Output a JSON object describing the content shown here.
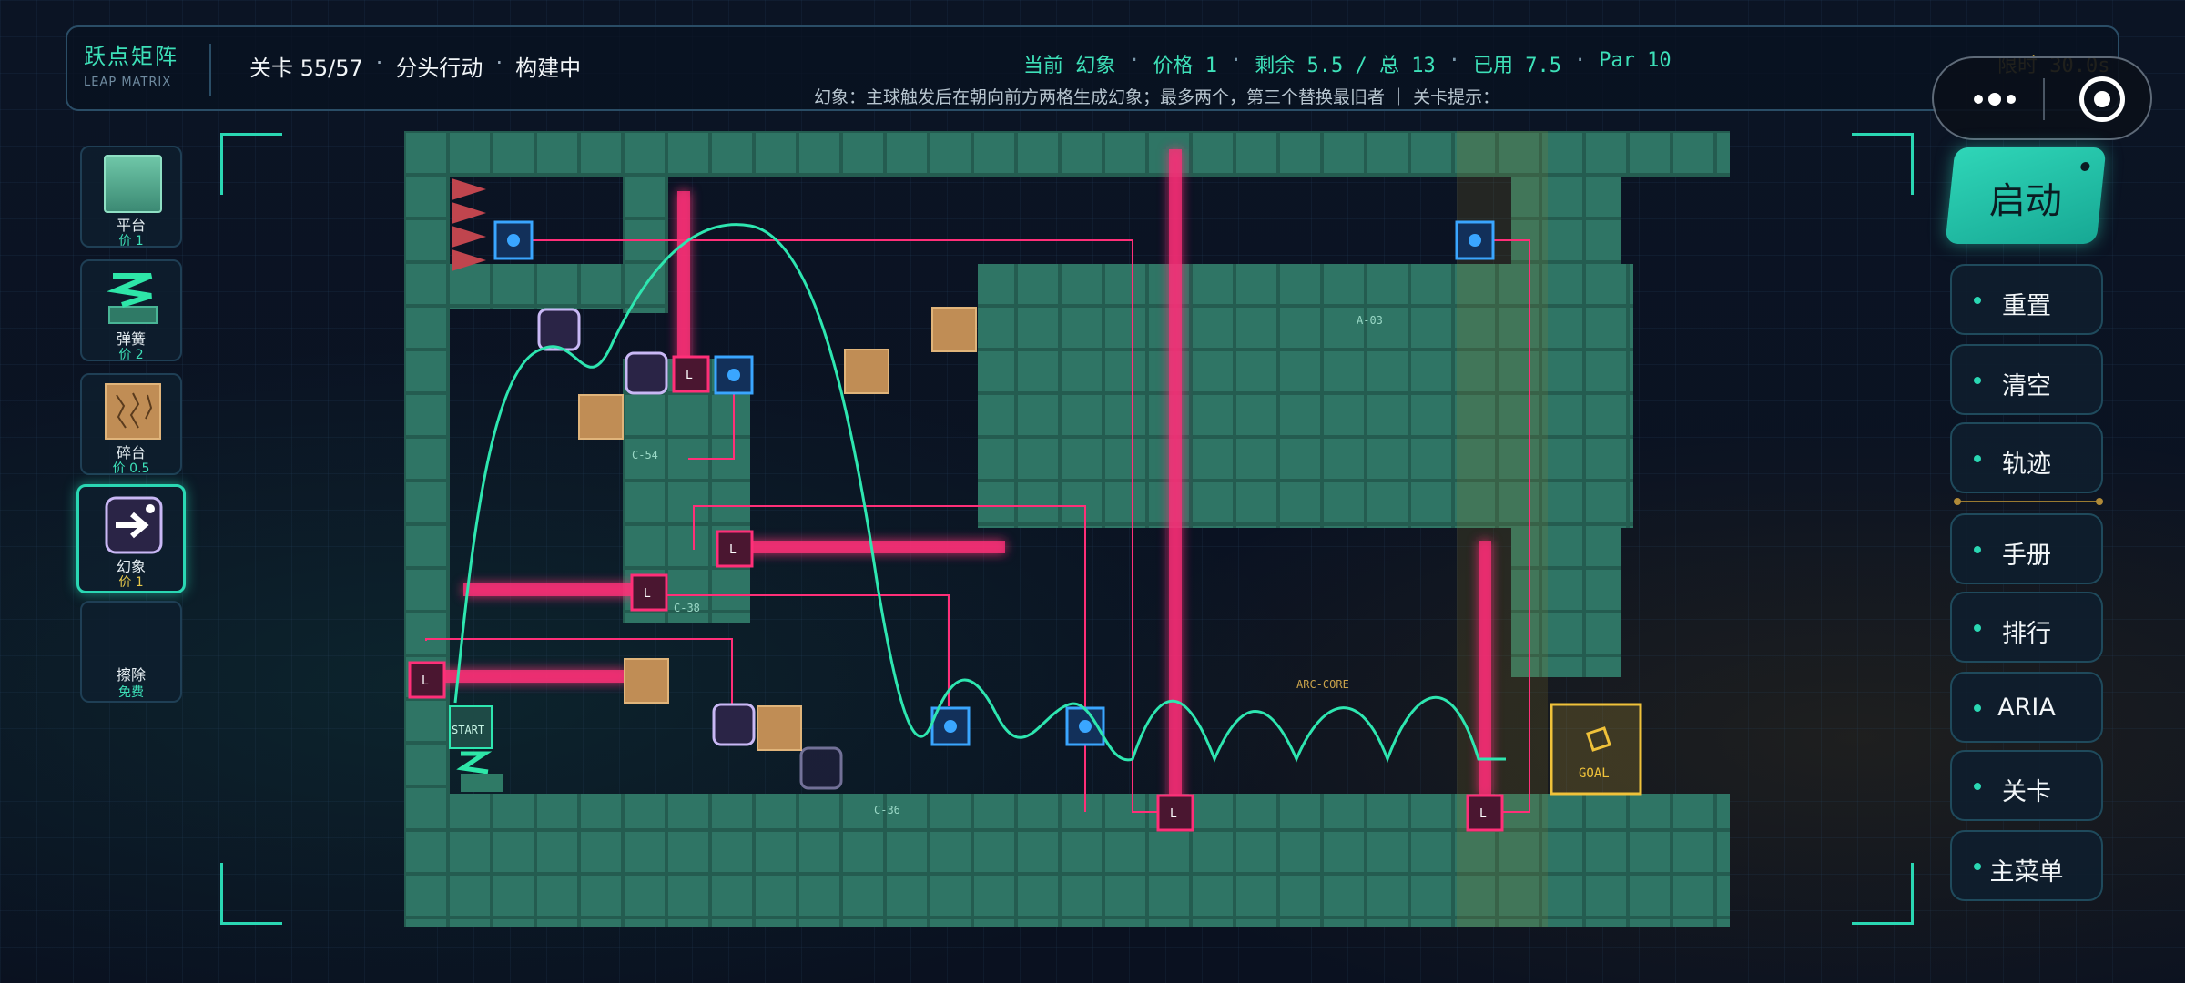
{
  "header": {
    "brand_title": "跃点矩阵",
    "brand_subtitle": "LEAP MATRIX",
    "level_label": "关卡 55/57",
    "level_name": "分头行动",
    "level_state": "构建中",
    "status": {
      "current": "当前 幻象",
      "price": "价格 1",
      "remaining": "剩余 5.5 / 总 13",
      "used": "已用 7.5",
      "par": "Par 10"
    },
    "hint": "幻象：主球触发后在朝向前方两格生成幻象；最多两个，第三个替换最旧者 ｜ 关卡提示：",
    "timer": "限时 30.0s"
  },
  "palette": [
    {
      "name": "平台",
      "price": "价 1",
      "icon": "platform-block"
    },
    {
      "name": "弹簧",
      "price": "价 2",
      "icon": "spring"
    },
    {
      "name": "碎台",
      "price": "价 0.5",
      "icon": "cracked-platform"
    },
    {
      "name": "幻象",
      "price": "价 1",
      "icon": "phantom-arrow",
      "selected": true
    },
    {
      "name": "擦除",
      "price": "免费",
      "icon": "eraser"
    }
  ],
  "board": {
    "start_label": "START",
    "goal_label": "GOAL",
    "lasers": [
      "L",
      "L",
      "L",
      "L",
      "L",
      "L"
    ],
    "zone_labels": [
      "C-54",
      "C-38",
      "C-36",
      "A-03",
      "ARC-CORE"
    ],
    "colors": {
      "wall": "#2e7a6c",
      "laser": "#ff2f78",
      "trajectory": "#2ee6b0",
      "goal": "#f0c23a",
      "phantom": "#b7a6f0",
      "sensor": "#3aa6ff",
      "crumble": "#c2915a"
    }
  },
  "controls": {
    "start": "启动",
    "buttons": [
      "重置",
      "清空",
      "轨迹",
      "手册",
      "排行",
      "ARIA",
      "关卡",
      "主菜单"
    ]
  }
}
